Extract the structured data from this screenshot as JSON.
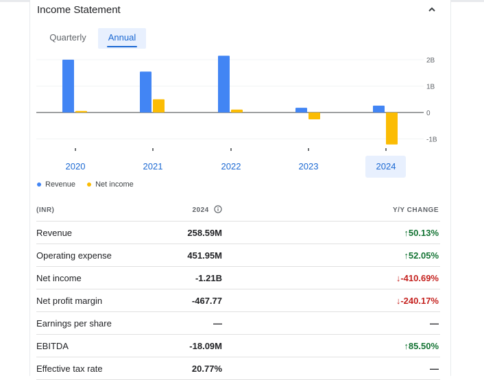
{
  "card": {
    "title": "Income Statement"
  },
  "tabs": [
    {
      "label": "Quarterly"
    },
    {
      "label": "Annual"
    }
  ],
  "chart_data": {
    "type": "bar",
    "categories": [
      "2020",
      "2021",
      "2022",
      "2023",
      "2024"
    ],
    "series": [
      {
        "name": "Revenue",
        "values": [
          2.0,
          1.55,
          2.15,
          0.18,
          0.26
        ],
        "color": "#4285f4"
      },
      {
        "name": "Net income",
        "values": [
          0.06,
          0.5,
          0.11,
          -0.26,
          -1.21
        ],
        "color": "#fbbc04"
      }
    ],
    "yticks": [
      "2B",
      "1B",
      "0",
      "-1B"
    ],
    "ylim": [
      -1.3,
      2.1
    ],
    "selected_category": "2024",
    "legend_position": "bottom-left"
  },
  "legend": [
    {
      "label": "Revenue",
      "color": "#4285f4"
    },
    {
      "label": "Net income",
      "color": "#fbbc04"
    }
  ],
  "table": {
    "headers": {
      "currency": "(INR)",
      "year": "2024",
      "change": "Y/Y CHANGE"
    },
    "rows": [
      {
        "label": "Revenue",
        "value": "258.59M",
        "change": "50.13%",
        "direction": "up"
      },
      {
        "label": "Operating expense",
        "value": "451.95M",
        "change": "52.05%",
        "direction": "up"
      },
      {
        "label": "Net income",
        "value": "-1.21B",
        "change": "-410.69%",
        "direction": "down"
      },
      {
        "label": "Net profit margin",
        "value": "-467.77",
        "change": "-240.17%",
        "direction": "down"
      },
      {
        "label": "Earnings per share",
        "value": "—",
        "change": "—",
        "direction": "none"
      },
      {
        "label": "EBITDA",
        "value": "-18.09M",
        "change": "85.50%",
        "direction": "up"
      },
      {
        "label": "Effective tax rate",
        "value": "20.77%",
        "change": "—",
        "direction": "none"
      }
    ]
  },
  "icons": {
    "collapse": "chevron-up-icon",
    "info": "info-icon",
    "up": "arrow-up-icon",
    "down": "arrow-down-icon"
  }
}
